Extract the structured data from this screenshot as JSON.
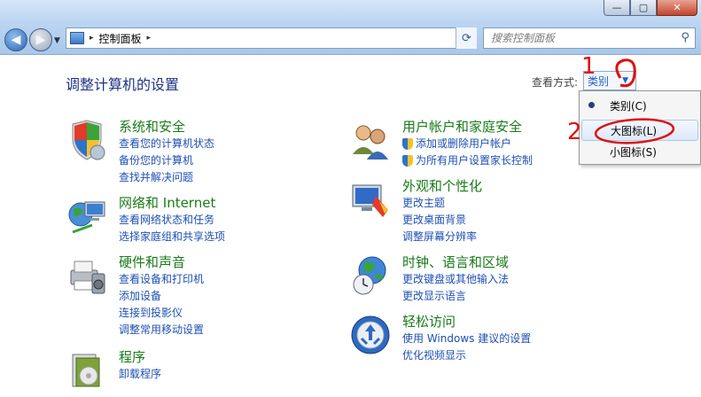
{
  "window": {
    "buttons": {
      "minimize": "—",
      "maximize": "▢",
      "close": "✕"
    }
  },
  "address_bar": {
    "crumbs": [
      "控制面板"
    ],
    "separator": "▸"
  },
  "search": {
    "placeholder": "搜索控制面板"
  },
  "page_title": "调整计算机的设置",
  "view_by": {
    "label": "查看方式:",
    "value": "类别",
    "options": [
      "类别(C)",
      "大图标(L)",
      "小图标(S)"
    ]
  },
  "categories": [
    {
      "title": "系统和安全",
      "links": [
        "查看您的计算机状态",
        "备份您的计算机",
        "查找并解决问题"
      ],
      "icon": "shield-icon"
    },
    {
      "title": "网络和 Internet",
      "links": [
        "查看网络状态和任务",
        "选择家庭组和共享选项"
      ],
      "icon": "network-icon"
    },
    {
      "title": "硬件和声音",
      "links": [
        "查看设备和打印机",
        "添加设备",
        "连接到投影仪",
        "调整常用移动设置"
      ],
      "icon": "printer-icon"
    },
    {
      "title": "程序",
      "links": [
        "卸载程序"
      ],
      "icon": "programs-icon"
    },
    {
      "title": "用户帐户和家庭安全",
      "links": [
        "添加或删除用户帐户",
        "为所有用户设置家长控制"
      ],
      "icon": "users-icon"
    },
    {
      "title": "外观和个性化",
      "links": [
        "更改主题",
        "更改桌面背景",
        "调整屏幕分辨率"
      ],
      "icon": "appearance-icon"
    },
    {
      "title": "时钟、语言和区域",
      "links": [
        "更改键盘或其他输入法",
        "更改显示语言"
      ],
      "icon": "globe-clock-icon"
    },
    {
      "title": "轻松访问",
      "links": [
        "使用 Windows 建议的设置",
        "优化视频显示"
      ],
      "icon": "ease-of-access-icon"
    }
  ],
  "annotations": [
    "1",
    "2"
  ],
  "colors": {
    "link": "#1f4fb4",
    "category_title": "#1a7a1a",
    "title": "#1e3287",
    "annotation": "#e01010"
  }
}
